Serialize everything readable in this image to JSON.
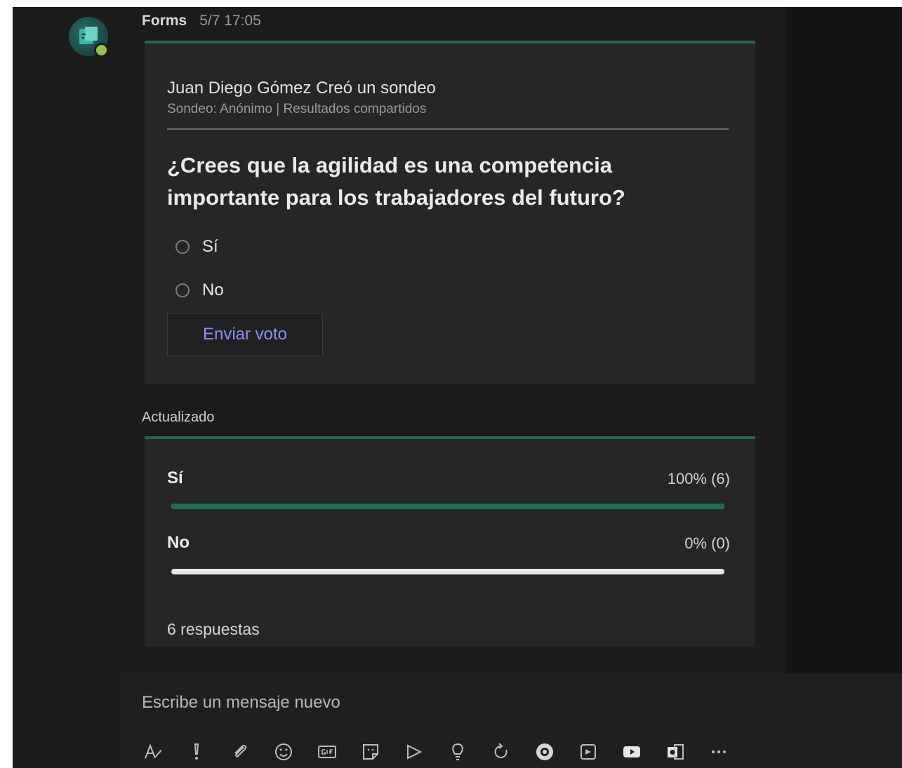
{
  "message": {
    "sender": "Forms",
    "timestamp": "5/7 17:05",
    "avatar_icon": "forms-app-icon"
  },
  "poll": {
    "creator_line": "Juan Diego Gómez Creó un sondeo",
    "meta_line": "Sondeo: Anónimo | Resultados compartidos",
    "question": "¿Crees que la agilidad es una competencia importante para los trabajadores del futuro?",
    "options": [
      {
        "label": "Sí"
      },
      {
        "label": "No"
      }
    ],
    "vote_button": "Enviar voto",
    "accent_color": "#1e6a52",
    "button_text_color": "#8b8ff5"
  },
  "results": {
    "header": "Actualizado",
    "rows": [
      {
        "label": "Sí",
        "value_text": "100% (6)",
        "fraction": 1.0
      },
      {
        "label": "No",
        "value_text": "0% (0)",
        "fraction": 0.0
      }
    ],
    "total": "6 respuestas"
  },
  "compose": {
    "placeholder": "Escribe un mensaje nuevo",
    "tools": [
      "format-icon",
      "priority-icon",
      "attach-icon",
      "emoji-icon",
      "gif-icon",
      "sticker-icon",
      "meet-now-icon",
      "praise-icon",
      "loop-icon",
      "camera-icon",
      "stream-icon",
      "youtube-icon",
      "office-icon",
      "more-options-icon"
    ]
  }
}
